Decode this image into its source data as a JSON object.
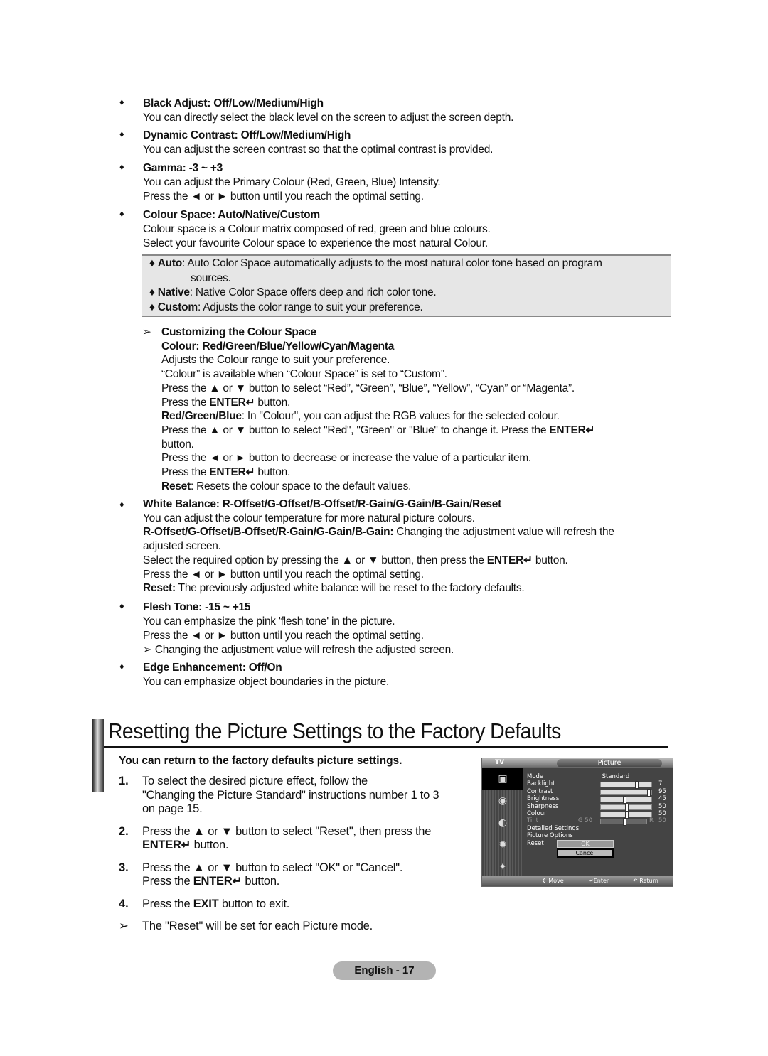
{
  "items": [
    {
      "heading": "Black Adjust: Off/Low/Medium/High",
      "lines": [
        "You can directly select the black level on the screen to adjust the screen depth."
      ]
    },
    {
      "heading": "Dynamic Contrast: Off/Low/Medium/High",
      "lines": [
        "You can adjust the screen contrast so that the optimal contrast is provided."
      ]
    },
    {
      "heading": "Gamma: -3 ~ +3",
      "lines": [
        "You can adjust the Primary Colour (Red, Green, Blue) Intensity.",
        "Press the ◄ or ► button until you reach the optimal setting."
      ]
    },
    {
      "heading": "Colour Space: Auto/Native/Custom",
      "lines": [
        "Colour space is a Colour matrix composed of red, green and blue colours.",
        "Select your favourite Colour space to experience the most natural Colour."
      ]
    }
  ],
  "note_box": [
    {
      "term": "Auto",
      "text": ": Auto Color Space automatically adjusts to the most natural color tone based on program",
      "cont": "sources."
    },
    {
      "term": "Native",
      "text": ": Native Color Space offers deep and rich color tone."
    },
    {
      "term": "Custom",
      "text": ": Adjusts the color range to suit your preference."
    }
  ],
  "custom_tip": {
    "arrow": "➢",
    "heading": "Customizing the Colour Space",
    "subheading": "Colour: Red/Green/Blue/Yellow/Cyan/Magenta",
    "l1": "Adjusts the Colour range to suit your preference.",
    "l2": "“Colour” is available when “Colour Space” is set to “Custom”.",
    "l3": "Press the ▲ or ▼ button to select “Red”, “Green”, “Blue”, “Yellow”, “Cyan” or “Magenta”.",
    "l4a": "Press the ",
    "enter": "ENTER↵",
    "l4b": " button.",
    "rgb_term": "Red/Green/Blue",
    "rgb_text": ": In \"Colour\", you can adjust the RGB values for the selected colour.",
    "l6a": "Press the ▲ or ▼ button to select \"Red\", \"Green\" or \"Blue\" to change it. Press the ",
    "l7": "button.",
    "l8": "Press the ◄ or ► button to decrease or increase the value of a particular item.",
    "reset_term": "Reset",
    "reset_text": ": Resets the colour space to the default values."
  },
  "white_balance": {
    "heading": "White Balance: R-Offset/G-Offset/B-Offset/R-Gain/G-Gain/B-Gain/Reset",
    "l1": "You can adjust the colour temperature for more natural picture colours.",
    "l2_term": "R-Offset/G-Offset/B-Offset/R-Gain/G-Gain/B-Gain:",
    "l2_text": " Changing the adjustment value will refresh the",
    "l3": "adjusted screen.",
    "l4a": "Select the required option by pressing the ▲ or ▼ button, then press the ",
    "l4b": " button.",
    "l5": "Press the ◄ or ► button until you reach the optimal setting.",
    "l6_term": "Reset:",
    "l6_text": " The previously adjusted white balance will be reset to the factory defaults."
  },
  "flesh_tone": {
    "heading": "Flesh Tone: -15 ~ +15",
    "l1": "You can emphasize the pink 'flesh tone' in the picture.",
    "l2": "Press the ◄ or ► button until you reach the optimal setting.",
    "l3": "Changing the adjustment value will refresh the adjusted screen."
  },
  "edge": {
    "heading": "Edge Enhancement: Off/On",
    "l1": "You can emphasize object boundaries in the picture."
  },
  "section": {
    "title": "Resetting the Picture Settings to the Factory Defaults",
    "subtitle": "You can return to the factory defaults picture settings.",
    "steps": [
      {
        "num": "1.",
        "lines": [
          "To select the desired picture effect, follow the",
          "\"Changing the Picture Standard\" instructions number 1 to 3",
          "on page 15."
        ]
      },
      {
        "num": "2.",
        "a": "Press the ▲ or ▼ button to select \"Reset\", then press the",
        "b": " button."
      },
      {
        "num": "3.",
        "a": "Press the ▲ or ▼ button to select \"OK\" or \"Cancel\".",
        "b1": "Press the ",
        "b2": " button."
      },
      {
        "num": "4.",
        "a": "Press the ",
        "exit": "EXIT",
        "b": " button to exit."
      }
    ],
    "note": "The \"Reset\" will be set for each Picture mode."
  },
  "osd": {
    "source": "TV",
    "tab": "Picture",
    "mode_label": "Mode",
    "mode_value": ": Standard",
    "sliders": [
      {
        "label": "Backlight",
        "value": "7",
        "level": 0.7
      },
      {
        "label": "Contrast",
        "value": "95",
        "level": 0.95
      },
      {
        "label": "Brightness",
        "value": "45",
        "level": 0.45
      },
      {
        "label": "Sharpness",
        "value": "50",
        "level": 0.5
      },
      {
        "label": "Colour",
        "value": "50",
        "level": 0.5
      }
    ],
    "tint": {
      "label": "Tint",
      "g": "G 50",
      "r": "R",
      "value": "50",
      "level": 0.5
    },
    "detailed": "Detailed Settings",
    "options": "Picture Options",
    "reset": "Reset",
    "ok": "OK",
    "cancel": "Cancel",
    "move": "⇕ Move",
    "enter": "↵Enter",
    "return": "↶ Return"
  },
  "footer": "English - 17",
  "bullet": "♦",
  "enter_label": "ENTER↵"
}
